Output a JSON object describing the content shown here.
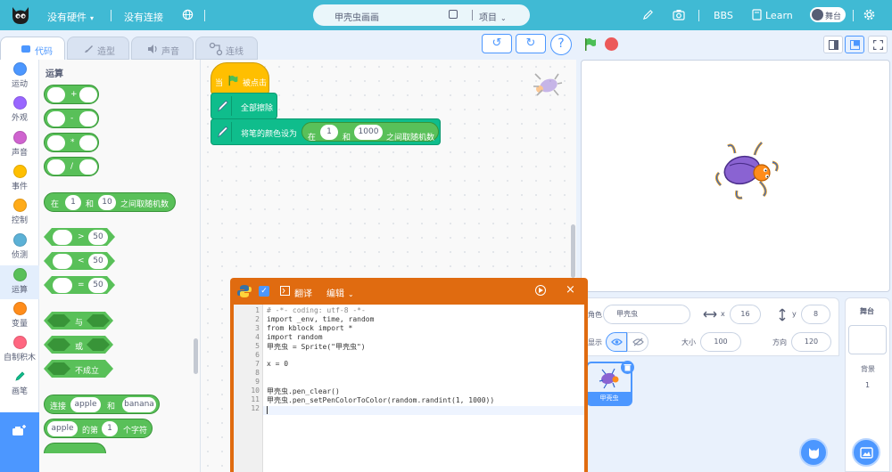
{
  "topbar": {
    "hardware": "没有硬件",
    "connection": "没有连接",
    "project_name": "甲壳虫画画",
    "project_menu": "项目",
    "bbs": "BBS",
    "learn": "Learn",
    "stage_toggle": "舞台"
  },
  "tabs": [
    {
      "label": "代码"
    },
    {
      "label": "造型"
    },
    {
      "label": "声音"
    },
    {
      "label": "连线"
    }
  ],
  "categories": [
    {
      "label": "运动",
      "color": "#4c97ff"
    },
    {
      "label": "外观",
      "color": "#9966ff"
    },
    {
      "label": "声音",
      "color": "#cf63cf"
    },
    {
      "label": "事件",
      "color": "#ffbf00"
    },
    {
      "label": "控制",
      "color": "#ffab19"
    },
    {
      "label": "侦测",
      "color": "#5cb1d6"
    },
    {
      "label": "运算",
      "color": "#59c059"
    },
    {
      "label": "变量",
      "color": "#ff8c1a"
    },
    {
      "label": "自制积木",
      "color": "#ff6680"
    },
    {
      "label": "画笔",
      "color": "#0fbd8c"
    }
  ],
  "palette": {
    "title": "运算",
    "ops": [
      "+",
      "-",
      "*",
      "/"
    ],
    "random": {
      "pre": "在",
      "a": "1",
      "mid": "和",
      "b": "10",
      "post": "之间取随机数"
    },
    "compare": [
      {
        "op": ">",
        "value": "50"
      },
      {
        "op": "<",
        "value": "50"
      },
      {
        "op": "=",
        "value": "50"
      }
    ],
    "logic": [
      "与",
      "或",
      "不成立"
    ],
    "join": {
      "pre": "连接",
      "a": "apple",
      "mid": "和",
      "b": "banana"
    },
    "letter": {
      "a": "apple",
      "mid": "的第",
      "n": "1",
      "post": "个字符"
    }
  },
  "script": {
    "hat_when": "当",
    "hat_clicked": "被点击",
    "clear": "全部擦除",
    "set_color": "将笔的颜色设为",
    "rand_pre": "在",
    "rand_a": "1",
    "rand_mid": "和",
    "rand_b": "1000",
    "rand_post": "之间取随机数"
  },
  "sprite_info": {
    "role_label": "角色",
    "name": "甲壳虫",
    "x_label": "x",
    "x": "16",
    "y_label": "y",
    "y": "8",
    "show_label": "显示",
    "size_label": "大小",
    "size": "100",
    "dir_label": "方向",
    "direction": "120",
    "sprite_card": "甲壳虫"
  },
  "stage_panel": {
    "title": "舞台",
    "backdrop_label": "背景",
    "backdrop_count": "1"
  },
  "python": {
    "translate": "翻译",
    "edit": "编辑",
    "lines": [
      "# -*- coding: utf-8 -*-",
      "import _env, time, random",
      "from kblock import *",
      "import random",
      "甲壳虫 = Sprite(\"甲壳虫\")",
      "",
      "x = 0",
      "",
      "",
      "甲壳虫.pen_clear()",
      "甲壳虫.pen_setPenColorToColor(random.randint(1, 1000))",
      ""
    ]
  },
  "colors": {
    "topbar": "#40bad4",
    "accent": "#4c97ff",
    "operators": "#59c059",
    "pen": "#0fbd8c",
    "events": "#ffbf00",
    "python_window": "#e06b10"
  }
}
